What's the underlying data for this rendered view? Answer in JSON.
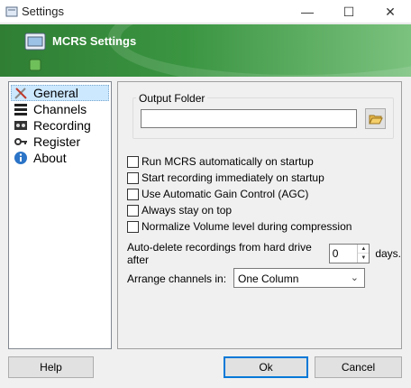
{
  "window": {
    "title": "Settings"
  },
  "banner": {
    "title": "MCRS Settings"
  },
  "nav": {
    "items": [
      {
        "label": "General",
        "icon": "tools-icon",
        "selected": true
      },
      {
        "label": "Channels",
        "icon": "bars-icon",
        "selected": false
      },
      {
        "label": "Recording",
        "icon": "tape-icon",
        "selected": false
      },
      {
        "label": "Register",
        "icon": "key-icon",
        "selected": false
      },
      {
        "label": "About",
        "icon": "info-icon",
        "selected": false
      }
    ]
  },
  "general": {
    "output_folder_label": "Output Folder",
    "output_folder_value": "",
    "options": [
      {
        "label": "Run MCRS automatically on startup",
        "checked": false
      },
      {
        "label": "Start recording immediately on startup",
        "checked": false
      },
      {
        "label": "Use Automatic Gain Control (AGC)",
        "checked": false
      },
      {
        "label": "Always stay on top",
        "checked": false
      },
      {
        "label": "Normalize Volume level during compression",
        "checked": false
      }
    ],
    "autodelete_label": "Auto-delete recordings from hard drive after",
    "autodelete_value": "0",
    "autodelete_unit": "days.",
    "arrange_label": "Arrange channels in:",
    "arrange_value": "One Column"
  },
  "buttons": {
    "help": "Help",
    "ok": "Ok",
    "cancel": "Cancel"
  },
  "colors": {
    "banner": "#3a9541",
    "selection": "#cce8ff",
    "default_button_border": "#0078d7"
  }
}
